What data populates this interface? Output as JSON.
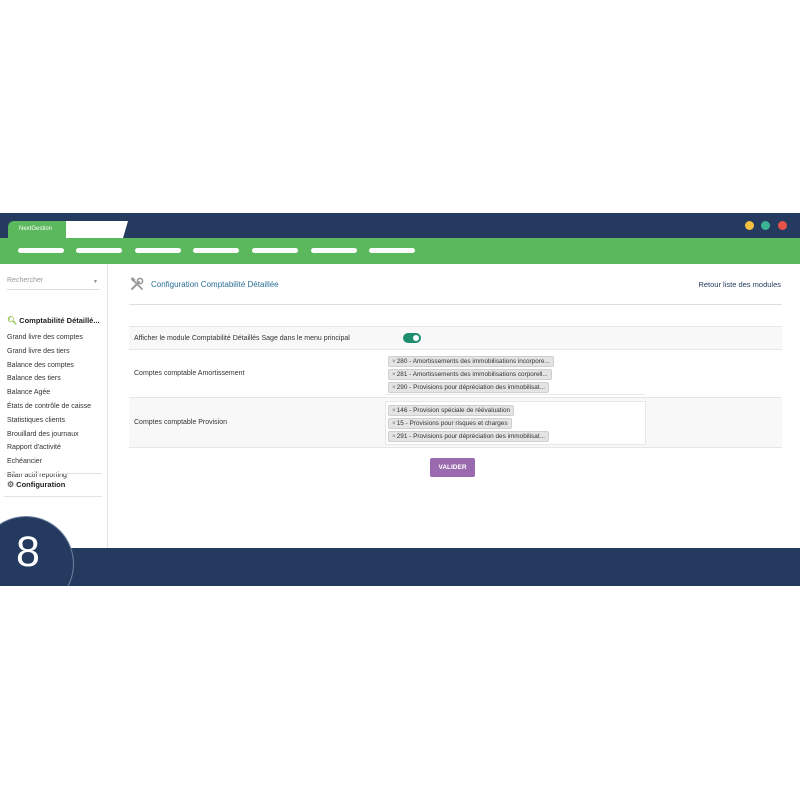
{
  "titlebar": {
    "app_tab": "NextGestion",
    "window_dots": [
      "#f5c042",
      "#3cb494",
      "#e5534b"
    ]
  },
  "colors": {
    "navy": "#243a5e",
    "green": "#5cb85c",
    "accent": "#9a6aae",
    "link": "#2a6f97"
  },
  "sidebar": {
    "search_placeholder": "Rechercher",
    "section_title": "Comptabilité Détaillé...",
    "items": [
      "Grand livre des comptes",
      "Grand livre des tiers",
      "Balance des comptes",
      "Balance des tiers",
      "Balance Agée",
      "États de contrôle de caisse",
      "Statistiques clients",
      "Brouillard des journaux",
      "Rapport d'activité",
      "Echéancier",
      "Bilan actif reporting"
    ],
    "config_label": "Configuration"
  },
  "main": {
    "title": "Configuration Comptabilité Détaillée",
    "back_link": "Retour liste des modules",
    "rows": [
      {
        "label": "Afficher le module Comptabilité Détaillés Sage dans le menu principal",
        "toggle_on": true
      },
      {
        "label": "Comptes comptable Amortissement",
        "chips": [
          "280 - Amortissements des immobilisations incorpore...",
          "281 - Amortissements des immobilisations corporell...",
          "290 - Provisions pour dépréciation des immobilisat..."
        ]
      },
      {
        "label": "Comptes comptable Provision",
        "chips": [
          "146 - Provision spéciale de réévaluation",
          "15 - Provisions pour risques et charges",
          "291 - Provisions pour dépréciation des immobilisat..."
        ]
      }
    ],
    "submit": "VALIDER"
  },
  "badge": {
    "number": "8"
  }
}
